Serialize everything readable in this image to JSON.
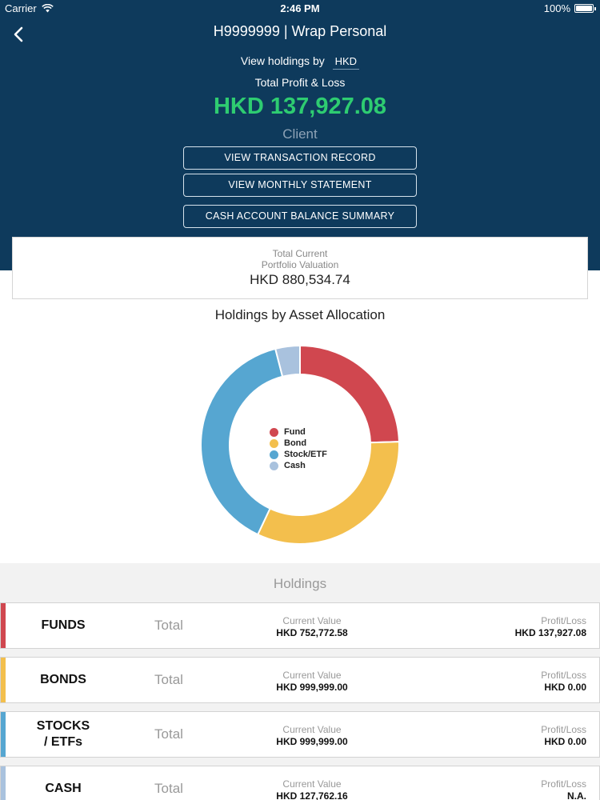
{
  "status_bar": {
    "carrier": "Carrier",
    "time": "2:46 PM",
    "battery": "100%"
  },
  "nav": {
    "title": "H9999999 | Wrap Personal"
  },
  "summary": {
    "view_by_label": "View holdings by",
    "currency": "HKD",
    "total_pl_label": "Total Profit & Loss",
    "total_pl_value": "HKD 137,927.08",
    "client_label": "Client"
  },
  "buttons": {
    "transaction": "VIEW TRANSACTION RECORD",
    "monthly": "VIEW MONTHLY STATEMENT",
    "cash_summary": "CASH ACCOUNT BALANCE SUMMARY"
  },
  "valuation": {
    "label_line1": "Total Current",
    "label_line2": "Portfolio Valuation",
    "amount": "HKD 880,534.74"
  },
  "chart_data": {
    "type": "pie",
    "title": "Holdings by Asset Allocation",
    "categories": [
      "Fund",
      "Bond",
      "Stock/ETF",
      "Cash"
    ],
    "values": [
      24.5,
      32.5,
      39.0,
      4.0
    ],
    "colors": [
      "#d0474f",
      "#f3bf4d",
      "#56a6d1",
      "#a9c2de"
    ],
    "donut": true,
    "legend_position": "center"
  },
  "holdings": {
    "title": "Holdings",
    "rows": [
      {
        "name": "FUNDS",
        "total_label": "Total",
        "cv_label": "Current Value",
        "cv_value": "HKD 752,772.58",
        "pl_label": "Profit/Loss",
        "pl_value": "HKD 137,927.08",
        "color": "#d0474f"
      },
      {
        "name": "BONDS",
        "total_label": "Total",
        "cv_label": "Current Value",
        "cv_value": "HKD 999,999.00",
        "pl_label": "Profit/Loss",
        "pl_value": "HKD 0.00",
        "color": "#f3bf4d"
      },
      {
        "name": "STOCKS\n/ ETFs",
        "total_label": "Total",
        "cv_label": "Current Value",
        "cv_value": "HKD 999,999.00",
        "pl_label": "Profit/Loss",
        "pl_value": "HKD 0.00",
        "color": "#56a6d1"
      },
      {
        "name": "CASH",
        "total_label": "Total",
        "cv_label": "Current Value",
        "cv_value": "HKD 127,762.16",
        "pl_label": "Profit/Loss",
        "pl_value": "N.A.",
        "color": "#a9c2de"
      }
    ]
  }
}
